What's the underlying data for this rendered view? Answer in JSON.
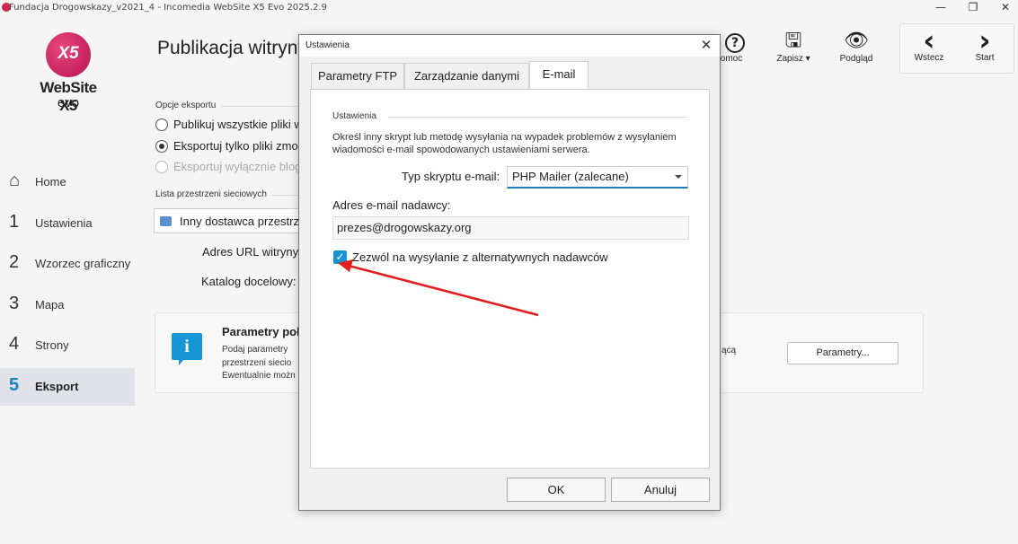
{
  "window": {
    "title": "Fundacja Drogowskazy_v2021_4 - Incomedia WebSite X5 Evo 2025.2.9",
    "minimize": "—",
    "restore": "❐",
    "close": "✕"
  },
  "logo": {
    "mark": "X5",
    "name": "WebSite X5",
    "edition": "evo"
  },
  "sidebar": {
    "items": [
      {
        "num": "⌂",
        "label": "Home"
      },
      {
        "num": "1",
        "label": "Ustawienia"
      },
      {
        "num": "2",
        "label": "Wzorzec graficzny"
      },
      {
        "num": "3",
        "label": "Mapa"
      },
      {
        "num": "4",
        "label": "Strony"
      },
      {
        "num": "5",
        "label": "Eksport"
      }
    ]
  },
  "main": {
    "title": "Publikacja witryny",
    "export_options_label": "Opcje eksportu",
    "radio1": "Publikuj wszystkie pliki w",
    "radio2": "Eksportuj tylko pliki zmo",
    "radio3": "Eksportuj wyłącznie blog",
    "network_list_label": "Lista przestrzeni sieciowych",
    "provider": "Inny dostawca przestrze",
    "url_label": "Adres URL witryny:",
    "folder_label": "Katalog docelowy:",
    "info_title": "Parametry połą",
    "info_line1": "Podaj parametry",
    "info_line2": "przestrzeni siecio",
    "info_line3": "Ewentualnie możn",
    "info_right": "ącą",
    "params_button": "Parametry..."
  },
  "toolbar": {
    "help": {
      "glyph": "?",
      "label": "omoc"
    },
    "save": {
      "glyph": "🖫",
      "label": "Zapisz ▾"
    },
    "preview": {
      "glyph": "👁",
      "label": "Podgląd"
    },
    "back": {
      "glyph": "‹",
      "label": "Wstecz"
    },
    "forward": {
      "glyph": "›",
      "label": "Start"
    }
  },
  "dialog": {
    "title": "Ustawienia",
    "close": "✕",
    "tabs": [
      "Parametry FTP",
      "Zarządzanie danymi",
      "E-mail"
    ],
    "active_tab": "E-mail",
    "group_label": "Ustawienia",
    "description": "Określ inny skrypt lub metodę wysyłania na wypadek problemów z wysyłaniem wiadomości e-mail spowodowanych ustawieniami serwera.",
    "script_type_label": "Typ skryptu e-mail:",
    "script_type_value": "PHP Mailer (zalecane)",
    "sender_label": "Adres e-mail nadawcy:",
    "sender_value": "prezes@drogowskazy.org",
    "checkbox_checked": true,
    "checkbox_label": "Zezwól na wysyłanie z alternatywnych nadawców",
    "ok": "OK",
    "cancel": "Anuluj"
  },
  "colors": {
    "accent": "#1596d6",
    "annotation_arrow": "#e51c1c",
    "logo": "#d0264f"
  }
}
